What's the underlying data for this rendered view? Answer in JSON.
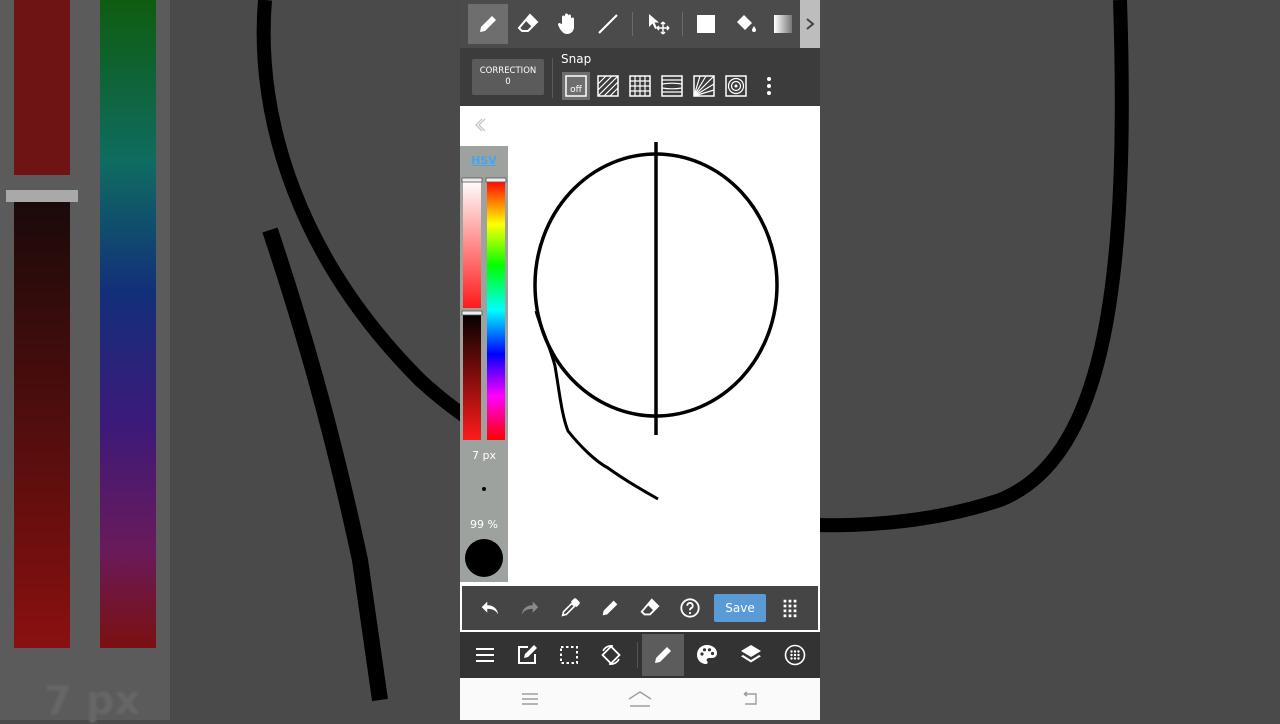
{
  "background": {
    "size_label": "7 px"
  },
  "toolbar": {
    "tools": [
      "pen-icon",
      "eraser-icon",
      "hand-icon",
      "line-icon",
      "select-move-icon",
      "rectangle-icon",
      "bucket-fill-icon",
      "gradient-icon"
    ],
    "selected": "pen-icon"
  },
  "correction": {
    "label": "CORRECTION",
    "value": "0"
  },
  "snap": {
    "label": "Snap",
    "off_label": "off",
    "options": [
      "off",
      "parallel",
      "grid",
      "vertical",
      "perspective",
      "concentric"
    ]
  },
  "palette": {
    "mode": "HSV",
    "brush_size": "7 px",
    "opacity": "99 %",
    "color": "#000000"
  },
  "action_bar": {
    "save_label": "Save"
  },
  "bottom_bar": {
    "items": [
      "menu-icon",
      "edit-icon",
      "selection-icon",
      "rotate-icon",
      "brush-icon",
      "palette-icon",
      "layers-icon",
      "material-icon"
    ],
    "selected": "brush-icon"
  },
  "colors": {
    "accent": "#5b9bd5",
    "hsv_link": "#42a5f5",
    "toolbar_bg": "#4b4b4b",
    "bottom_bg": "#333333"
  }
}
